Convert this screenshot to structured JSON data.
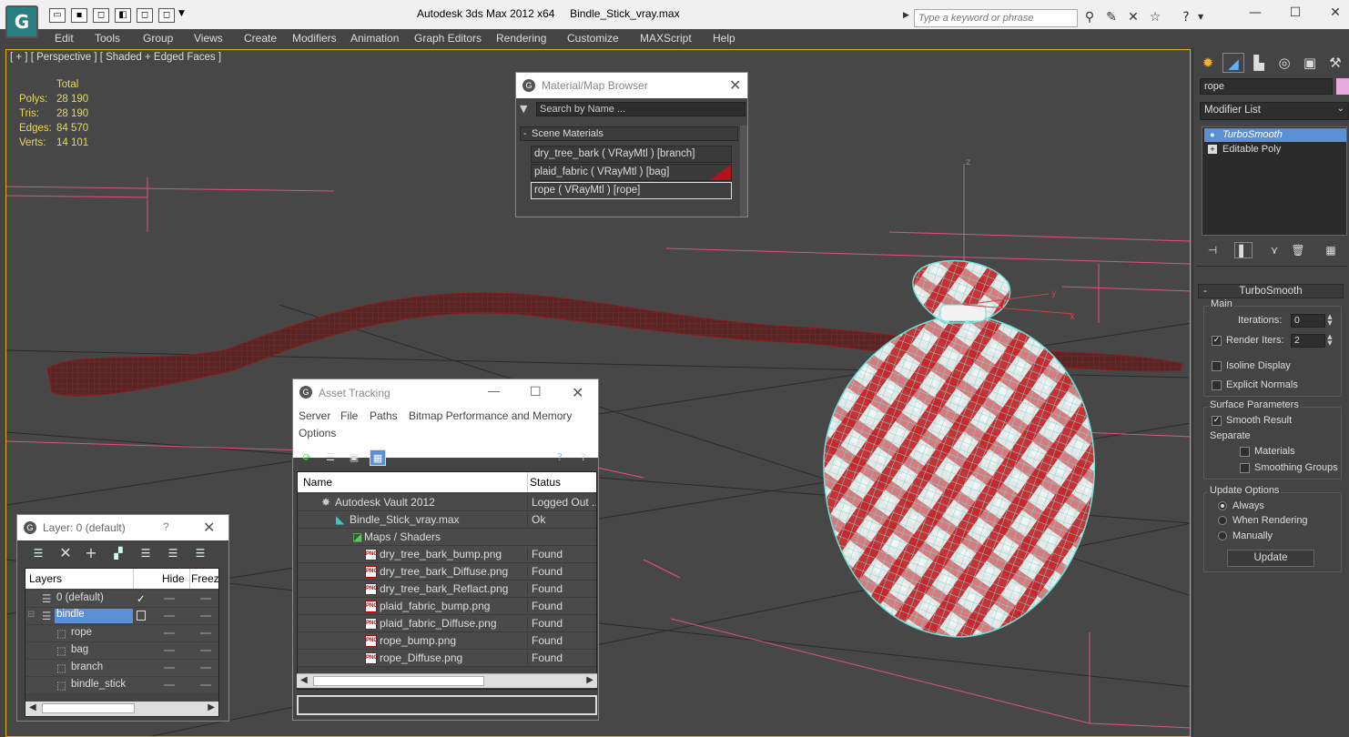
{
  "title": {
    "app": "Autodesk 3ds Max  2012 x64",
    "file": "Bindle_Stick_vray.max",
    "search_placeholder": "Type a keyword or phrase"
  },
  "menu": [
    "Edit",
    "Tools",
    "Group",
    "Views",
    "Create",
    "Modifiers",
    "Animation",
    "Graph Editors",
    "Rendering",
    "Customize",
    "MAXScript",
    "Help"
  ],
  "viewport": {
    "label": "[ + ] [ Perspective ] [ Shaded + Edged Faces ]",
    "stats_header": "Total",
    "stats": [
      {
        "label": "Polys:",
        "value": "28 190"
      },
      {
        "label": "Tris:",
        "value": "28 190"
      },
      {
        "label": "Edges:",
        "value": "84 570"
      },
      {
        "label": "Verts:",
        "value": "14 101"
      }
    ],
    "gizmo": {
      "x": "x",
      "y": "y",
      "z": "z"
    }
  },
  "command_panel": {
    "object_name": "rope",
    "object_color": "#e8a8e0",
    "modifier_list": "Modifier List",
    "stack": [
      "TurboSmooth",
      "Editable Poly"
    ],
    "turbosmooth": {
      "title": "TurboSmooth",
      "main_group": "Main",
      "iterations_label": "Iterations:",
      "iterations": "0",
      "render_iters_label": "Render Iters:",
      "render_iters": "2",
      "render_iters_checked": true,
      "isoline_display": "Isoline Display",
      "explicit_normals": "Explicit Normals",
      "surface_group": "Surface Parameters",
      "smooth_result": "Smooth Result",
      "separate": "Separate",
      "materials": "Materials",
      "smoothing_groups": "Smoothing Groups",
      "update_group": "Update Options",
      "update_always": "Always",
      "update_when_rendering": "When Rendering",
      "update_manually": "Manually",
      "update_button": "Update"
    }
  },
  "material_browser": {
    "title": "Material/Map Browser",
    "search_placeholder": "Search by Name ...",
    "section": "Scene Materials",
    "materials": [
      {
        "label": "dry_tree_bark  ( VRayMtl )  [branch]",
        "swatch": ""
      },
      {
        "label": "plaid_fabric  ( VRayMtl )  [bag]",
        "swatch": "#b0141a"
      },
      {
        "label": "rope  ( VRayMtl )  [rope]",
        "swatch": ""
      }
    ]
  },
  "asset_tracking": {
    "title": "Asset Tracking",
    "menu": [
      "Server",
      "File",
      "Paths",
      "Bitmap Performance and Memory",
      "Options"
    ],
    "columns": [
      "Name",
      "Status"
    ],
    "rows": [
      {
        "name": "Autodesk Vault 2012",
        "status": "Logged Out ..."
      },
      {
        "name": "Bindle_Stick_vray.max",
        "status": "Ok"
      },
      {
        "name": "Maps / Shaders",
        "status": ""
      },
      {
        "name": "dry_tree_bark_bump.png",
        "status": "Found"
      },
      {
        "name": "dry_tree_bark_Diffuse.png",
        "status": "Found"
      },
      {
        "name": "dry_tree_bark_Reflact.png",
        "status": "Found"
      },
      {
        "name": "plaid_fabric_bump.png",
        "status": "Found"
      },
      {
        "name": "plaid_fabric_Diffuse.png",
        "status": "Found"
      },
      {
        "name": "rope_bump.png",
        "status": "Found"
      },
      {
        "name": "rope_Diffuse.png",
        "status": "Found"
      }
    ],
    "png_tag": "PNG"
  },
  "layer_manager": {
    "title": "Layer: 0 (default)",
    "help": "?",
    "columns": [
      "Layers",
      "Hide",
      "Freeze"
    ],
    "rows": [
      {
        "name": "0 (default)"
      },
      {
        "name": "bindle"
      },
      {
        "name": "rope"
      },
      {
        "name": "bag"
      },
      {
        "name": "branch"
      },
      {
        "name": "bindle_stick"
      }
    ]
  }
}
